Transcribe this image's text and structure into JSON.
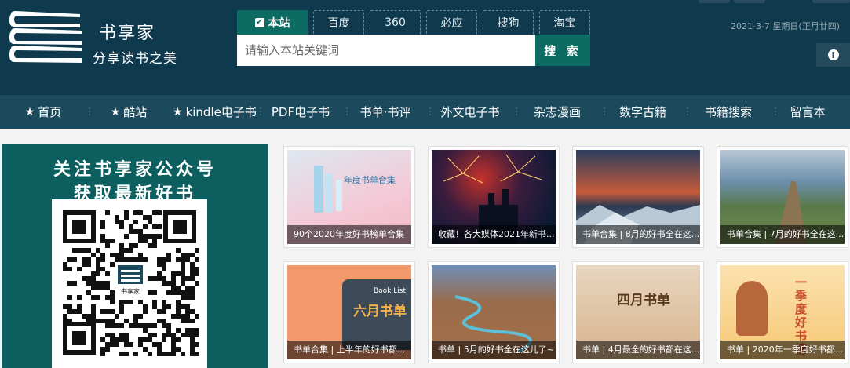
{
  "brand": {
    "title": "书享家",
    "subtitle": "分享读书之美",
    "qr_brand": "书享家"
  },
  "search": {
    "tabs": [
      {
        "label": "本站",
        "active": true
      },
      {
        "label": "百度"
      },
      {
        "label": "360"
      },
      {
        "label": "必应"
      },
      {
        "label": "搜狗"
      },
      {
        "label": "淘宝"
      }
    ],
    "placeholder": "请输入本站关键词",
    "button_label": "搜 索"
  },
  "date_text": "2021-3-7 星期日(正月廿四)",
  "info_icon": "info-icon",
  "nav": [
    {
      "label": "首页",
      "star": true
    },
    {
      "label": "酷站",
      "star": true
    },
    {
      "label": "kindle电子书",
      "star": true
    },
    {
      "label": "PDF电子书"
    },
    {
      "label": "书单·书评"
    },
    {
      "label": "外文电子书"
    },
    {
      "label": "杂志漫画"
    },
    {
      "label": "数字古籍"
    },
    {
      "label": "书籍搜索"
    },
    {
      "label": "留言本"
    }
  ],
  "qr": {
    "line1": "关注书享家公众号",
    "line2": "获取最新好书"
  },
  "posts": [
    {
      "caption": "90个2020年度好书榜单合集",
      "art_text": "年度书单合集"
    },
    {
      "caption": "收藏！各大媒体2021年新书...",
      "art_text": ""
    },
    {
      "caption": "书单合集 | 8月的好书全在这...",
      "art_text": ""
    },
    {
      "caption": "书单合集 | 7月的好书全在这...",
      "art_text": ""
    },
    {
      "caption": "书单合集 | 上半年的好书都...",
      "art_text": "六月书单",
      "art_sub": "Book List"
    },
    {
      "caption": "书单 | 5月的好书全在这儿了~",
      "art_text": ""
    },
    {
      "caption": "书单 | 4月最全的好书都在这...",
      "art_text": "四月书单"
    },
    {
      "caption": "书单 | 2020年一季度好书都...",
      "art_text": "一季度好书榜"
    }
  ],
  "colors": {
    "header_bg": "#0f3a4e",
    "nav_bg": "#1c4a5d",
    "accent": "#0c6b62",
    "qr_panel": "#0c5f5e"
  }
}
